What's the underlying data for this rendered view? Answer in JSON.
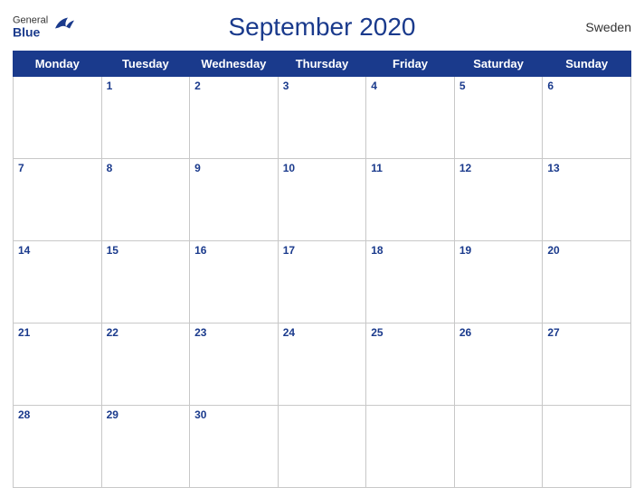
{
  "header": {
    "title": "September 2020",
    "country": "Sweden",
    "logo": {
      "general": "General",
      "blue": "Blue"
    }
  },
  "weekdays": [
    "Monday",
    "Tuesday",
    "Wednesday",
    "Thursday",
    "Friday",
    "Saturday",
    "Sunday"
  ],
  "weeks": [
    [
      {
        "day": "",
        "empty": true
      },
      {
        "day": "1"
      },
      {
        "day": "2"
      },
      {
        "day": "3"
      },
      {
        "day": "4"
      },
      {
        "day": "5"
      },
      {
        "day": "6"
      }
    ],
    [
      {
        "day": "7"
      },
      {
        "day": "8"
      },
      {
        "day": "9"
      },
      {
        "day": "10"
      },
      {
        "day": "11"
      },
      {
        "day": "12"
      },
      {
        "day": "13"
      }
    ],
    [
      {
        "day": "14"
      },
      {
        "day": "15"
      },
      {
        "day": "16"
      },
      {
        "day": "17"
      },
      {
        "day": "18"
      },
      {
        "day": "19"
      },
      {
        "day": "20"
      }
    ],
    [
      {
        "day": "21"
      },
      {
        "day": "22"
      },
      {
        "day": "23"
      },
      {
        "day": "24"
      },
      {
        "day": "25"
      },
      {
        "day": "26"
      },
      {
        "day": "27"
      }
    ],
    [
      {
        "day": "28"
      },
      {
        "day": "29"
      },
      {
        "day": "30"
      },
      {
        "day": "",
        "empty": true
      },
      {
        "day": "",
        "empty": true
      },
      {
        "day": "",
        "empty": true
      },
      {
        "day": "",
        "empty": true
      }
    ]
  ]
}
